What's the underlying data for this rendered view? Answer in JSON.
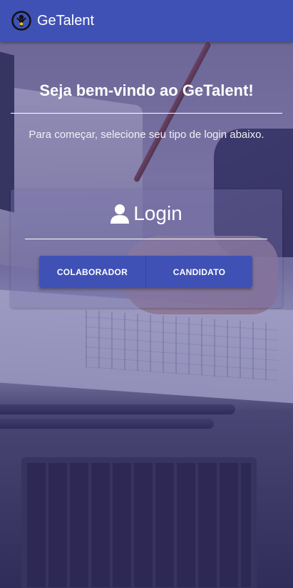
{
  "appbar": {
    "title": "GeTalent",
    "logo_icon": "getalent-logo-icon",
    "background": "#3f51b5"
  },
  "welcome": {
    "heading": "Seja bem-vindo ao GeTalent!",
    "subtitle": "Para começar, selecione seu tipo de login abaixo."
  },
  "login_card": {
    "icon": "user-icon",
    "title": "Login",
    "buttons": {
      "colaborador": "COLABORADOR",
      "candidato": "CANDIDATO"
    }
  },
  "colors": {
    "primary": "#3f51b5",
    "text": "#ffffff"
  }
}
